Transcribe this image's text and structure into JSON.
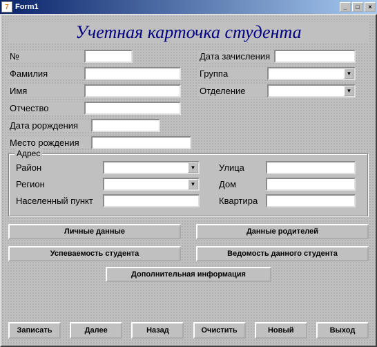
{
  "window": {
    "title": "Form1"
  },
  "heading": "Учетная карточка студента",
  "fields": {
    "number_label": "№",
    "surname_label": "Фамилия",
    "name_label": "Имя",
    "patronymic_label": "Отчество",
    "birthdate_label": "Дата рорждения",
    "birthplace_label": "Место рождения",
    "enroll_label": "Дата зачисления",
    "group_label": "Группа",
    "dept_label": "Отделение",
    "number": "",
    "surname": "",
    "name": "",
    "patronymic": "",
    "birthdate": "",
    "birthplace": "",
    "enroll": "",
    "group": "",
    "dept": ""
  },
  "address": {
    "title": "Адрес",
    "district_label": "Район",
    "region_label": "Регион",
    "city_label": "Населенный пункт",
    "street_label": "Улица",
    "house_label": "Дом",
    "apt_label": "Квартира",
    "district": "",
    "region": "",
    "city": "",
    "street": "",
    "house": "",
    "apt": ""
  },
  "buttons": {
    "personal": "Личные данные",
    "parents": "Данные родителей",
    "progress": "Успеваемость студента",
    "report": "Ведомость данного студента",
    "extra": "Дополнительная информация"
  },
  "nav": {
    "save": "Записать",
    "next": "Далее",
    "back": "Назад",
    "clear": "Очистить",
    "new": "Новый",
    "exit": "Выход"
  },
  "winbtns": {
    "min": "_",
    "max": "□",
    "close": "×"
  }
}
